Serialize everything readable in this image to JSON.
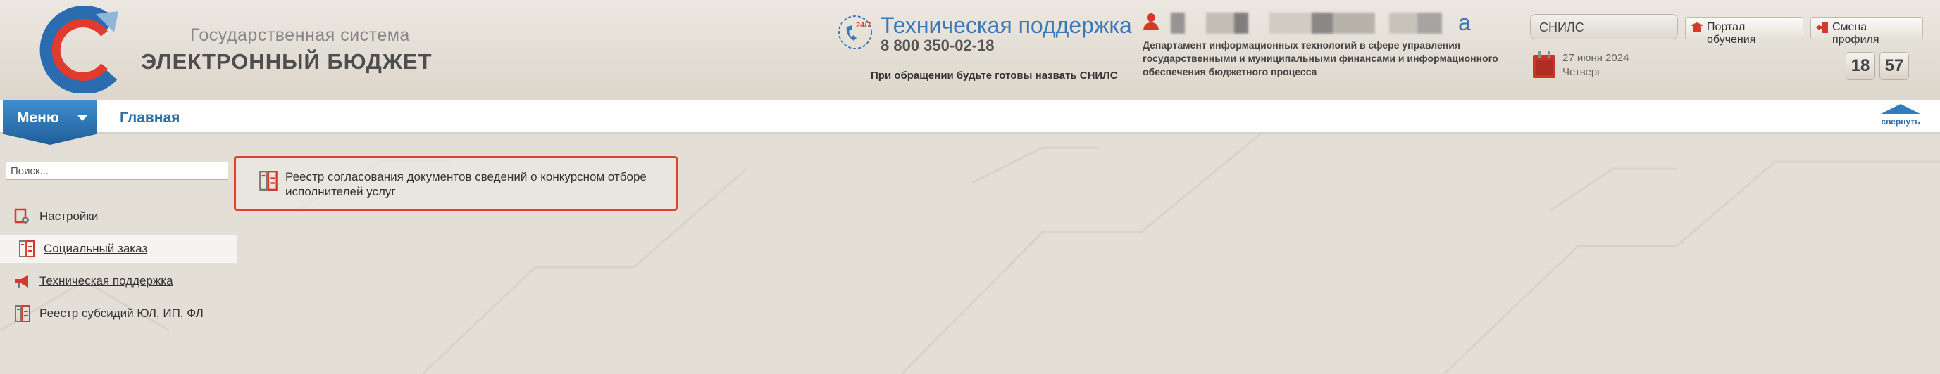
{
  "header": {
    "logo_line1": "Государственная система",
    "logo_line2": "ЭЛЕКТРОННЫЙ БЮДЖЕТ",
    "support_badge": "24/7",
    "support_title": "Техническая поддержка",
    "support_phone": "8 800 350-02-18",
    "support_note": "При обращении будьте готовы назвать СНИЛС",
    "user_name_tail": "а",
    "department": "Департамент информационных технологий в сфере управления государственными и муниципальными финансами и информационного обеспечения бюджетного процесса",
    "snils_label": "СНИЛС",
    "portal_button": "Портал обучения",
    "profile_button": "Смена профиля",
    "date": "27 июня 2024",
    "weekday": "Четверг",
    "clock_hours": "18",
    "clock_minutes": "57"
  },
  "nav": {
    "menu_label": "Меню",
    "home_label": "Главная",
    "collapse_label": "свернуть"
  },
  "sidebar": {
    "search_placeholder": "Поиск...",
    "items": [
      {
        "label": "Настройки",
        "icon": "settings-icon"
      },
      {
        "label": "Социальный заказ",
        "icon": "registry-icon"
      },
      {
        "label": "Техническая поддержка",
        "icon": "megaphone-icon"
      },
      {
        "label": "Реестр субсидий ЮЛ, ИП, ФЛ",
        "icon": "registry-icon"
      }
    ]
  },
  "main": {
    "cards": [
      {
        "label": "Реестр согласования документов сведений о конкурсном отборе исполнителей услуг",
        "icon": "registry-icon"
      }
    ]
  },
  "colors": {
    "accent_blue": "#3b78b8",
    "menu_blue": "#1f5f99",
    "highlight_red": "#e0412b",
    "background": "#e4dfd6"
  }
}
